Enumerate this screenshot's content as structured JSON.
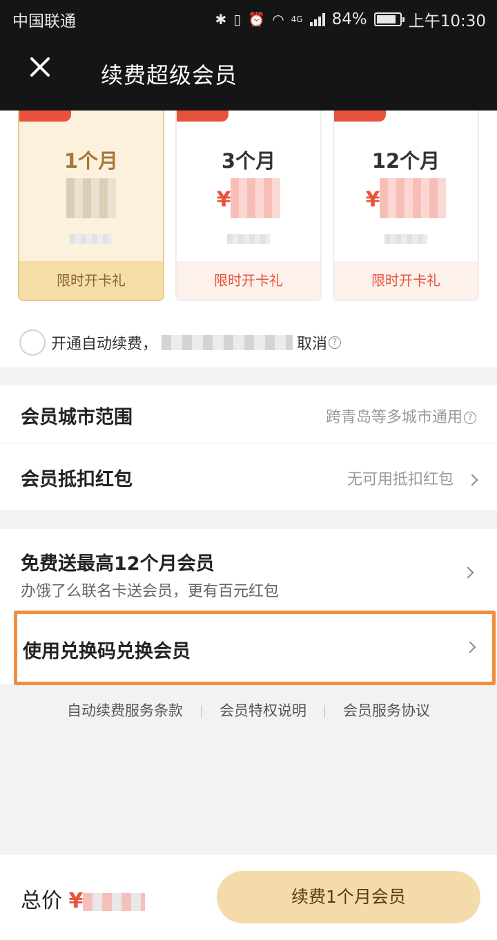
{
  "status_bar": {
    "carrier": "中国联通",
    "network": "4G",
    "battery": "84%",
    "battery_level": 0.84,
    "time": "上午10:30"
  },
  "header": {
    "title": "续费超级会员",
    "close_icon": "close-icon"
  },
  "plans": [
    {
      "duration": "1个月",
      "gift": "限时开卡礼",
      "selected": true
    },
    {
      "duration": "3个月",
      "gift": "限时开卡礼",
      "selected": false
    },
    {
      "duration": "12个月",
      "gift": "限时开卡礼",
      "selected": false
    }
  ],
  "auto_renew": {
    "label_start": "开通自动续费，",
    "label_end": "取消"
  },
  "city_scope": {
    "label": "会员城市范围",
    "value": "跨青岛等多城市通用"
  },
  "voucher": {
    "label": "会员抵扣红包",
    "value": "无可用抵扣红包"
  },
  "promo": {
    "title": "免费送最高12个月会员",
    "subtitle": "办饿了么联名卡送会员，更有百元红包"
  },
  "redeem": {
    "label": "使用兑换码兑换会员"
  },
  "links": [
    "自动续费服务条款",
    "会员特权说明",
    "会员服务协议"
  ],
  "bottom": {
    "total_label": "总价",
    "currency": "¥",
    "cta": "续费1个月会员"
  },
  "colors": {
    "accent_red": "#e8523d",
    "gold": "#f4dcaa",
    "highlight_orange": "#ef8f3e"
  }
}
